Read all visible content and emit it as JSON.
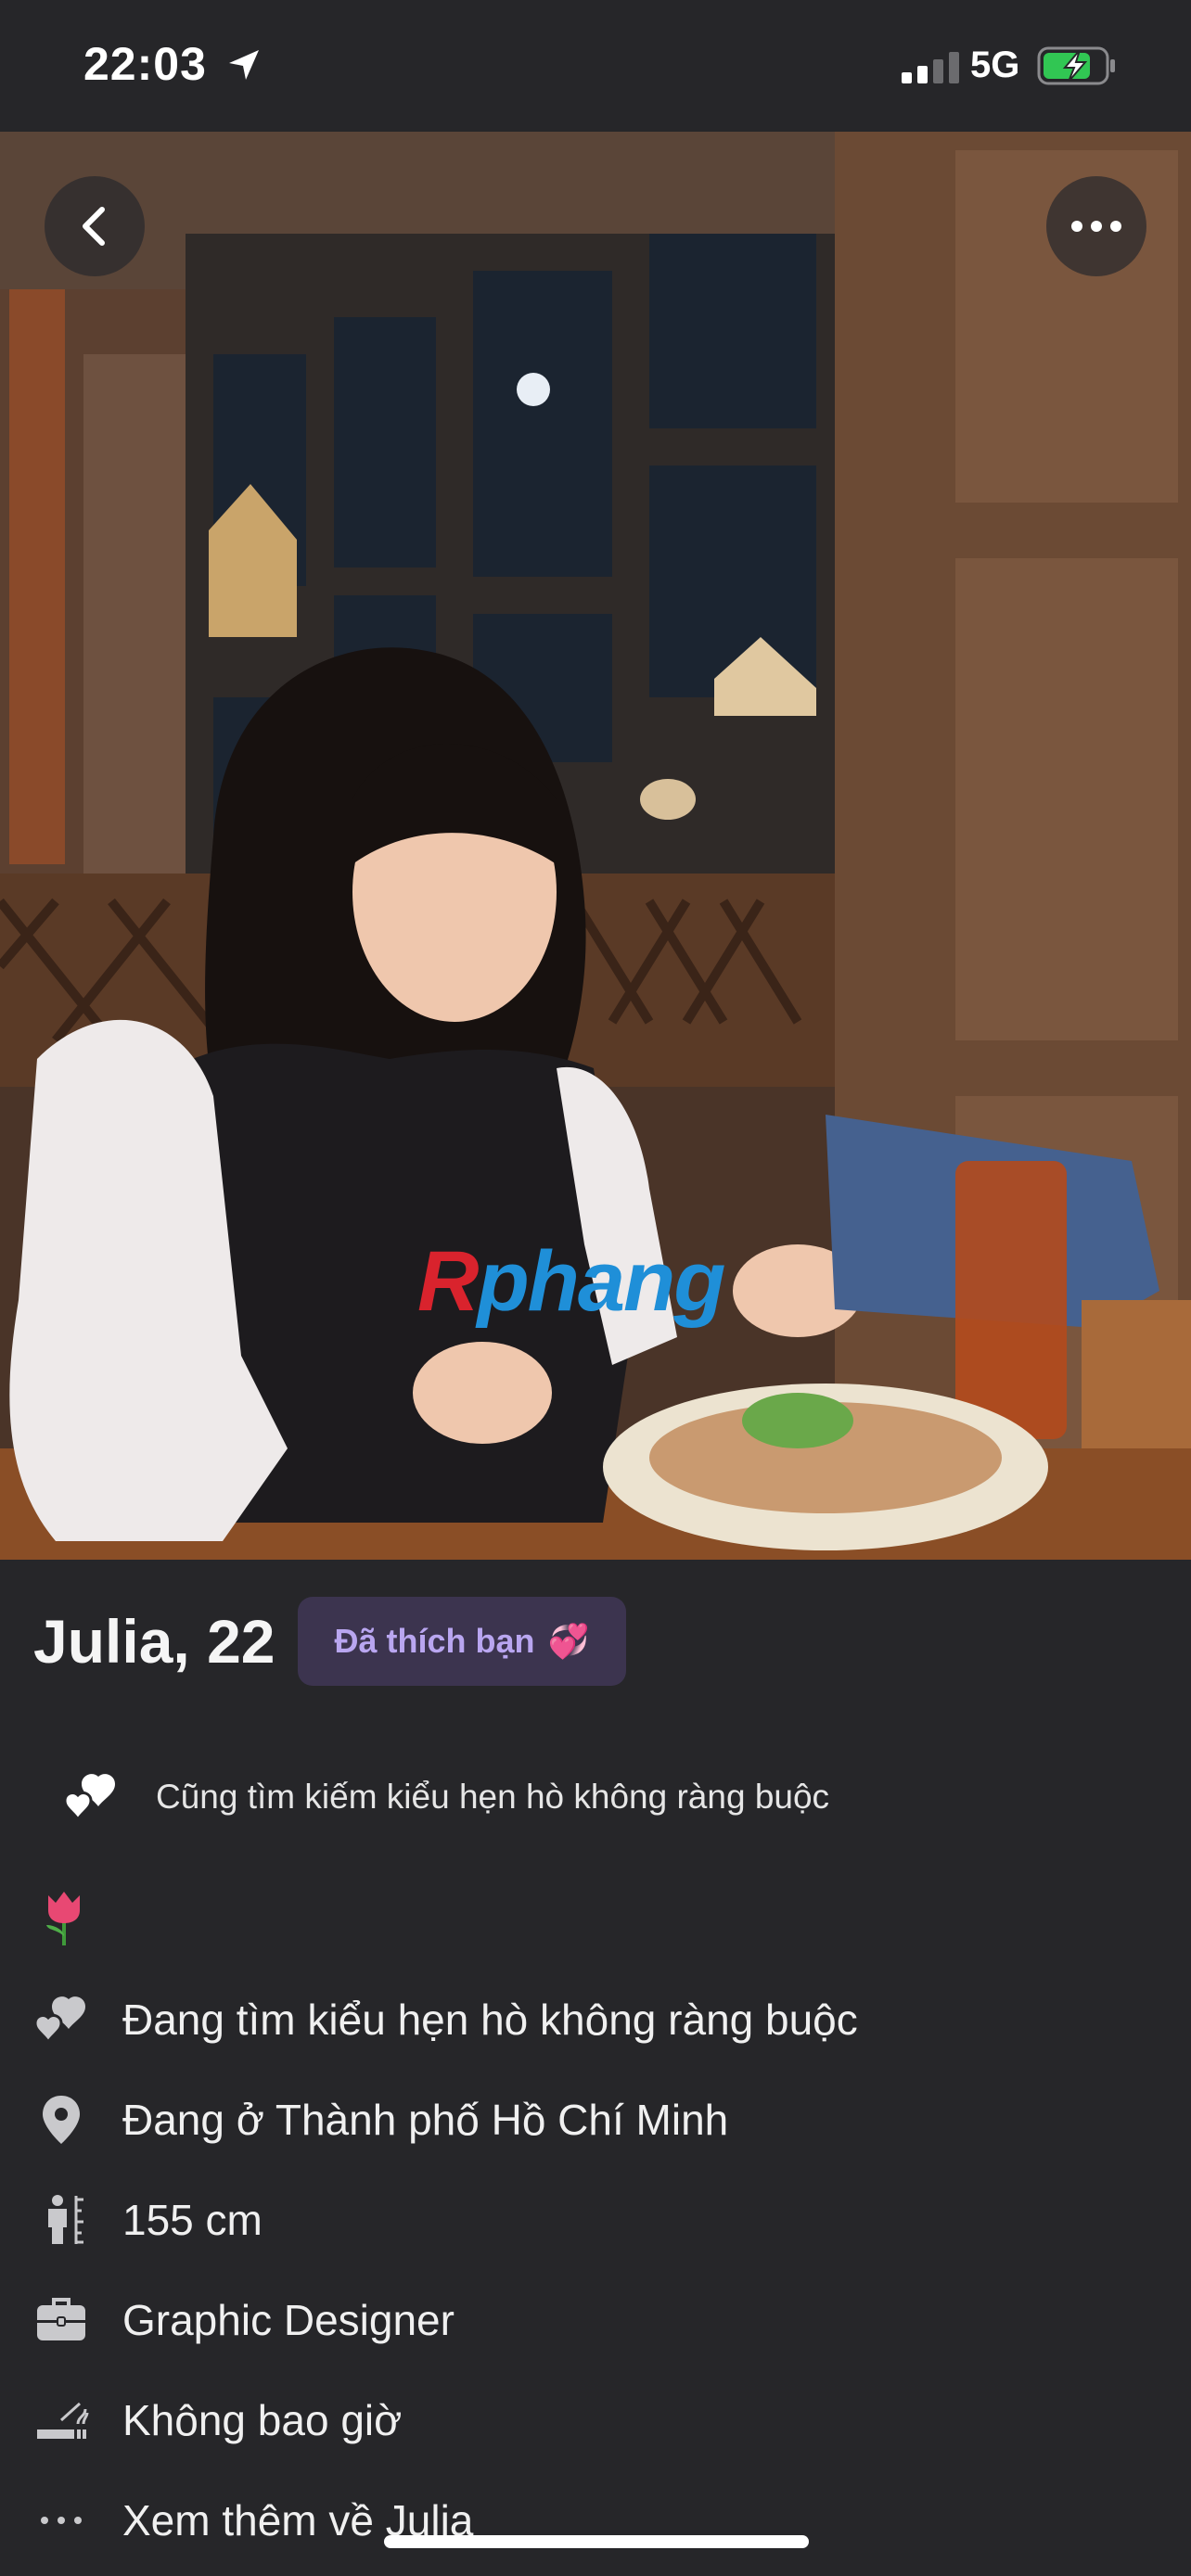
{
  "status_bar": {
    "time": "22:03",
    "network": "5G"
  },
  "photo": {
    "watermark_r": "R",
    "watermark_rest": "phang",
    "back_icon": "chevron-left-icon",
    "more_icon": "more-horizontal-icon"
  },
  "profile": {
    "name": "Julia, 22",
    "liked_badge": "Đã thích bạn",
    "liked_emoji": "💞",
    "shared_intent": "Cũng tìm kiếm kiểu hẹn hò không ràng buộc",
    "details": [
      {
        "icon": "hearts-icon",
        "text": "Đang tìm kiểu hẹn hò không ràng buộc"
      },
      {
        "icon": "location-pin-icon",
        "text": "Đang ở Thành phố Hồ Chí Minh"
      },
      {
        "icon": "height-icon",
        "text": "155 cm"
      },
      {
        "icon": "briefcase-icon",
        "text": "Graphic Designer"
      },
      {
        "icon": "smoking-icon",
        "text": "Không bao giờ"
      },
      {
        "icon": "more-dots-icon",
        "text": "Xem thêm về Julia"
      }
    ]
  },
  "colors": {
    "background": "#262629",
    "badge_bg": "#3c344f",
    "badge_text": "#b9a6f0"
  }
}
